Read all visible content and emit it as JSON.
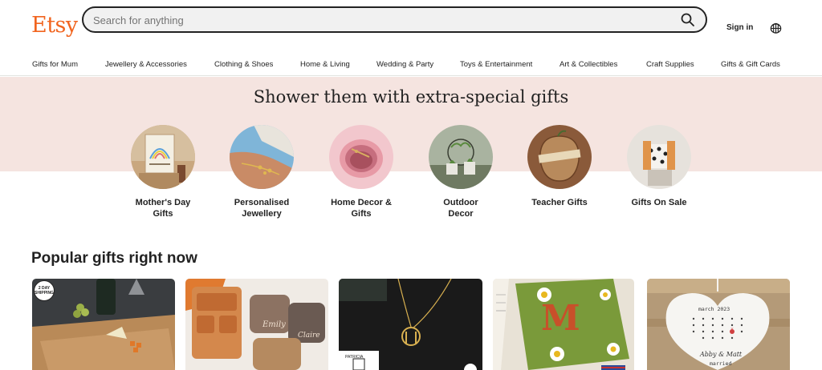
{
  "header": {
    "logo": "Etsy",
    "search": {
      "placeholder": "Search for anything"
    },
    "sign_in": "Sign in",
    "icons": {
      "search": "search-icon",
      "basket": "basket-icon"
    },
    "brand_color": "#f1641e"
  },
  "nav": {
    "items": [
      {
        "label": "Gifts for Mum"
      },
      {
        "label": "Jewellery & Accessories"
      },
      {
        "label": "Clothing & Shoes"
      },
      {
        "label": "Home & Living"
      },
      {
        "label": "Wedding & Party"
      },
      {
        "label": "Toys & Entertainment"
      },
      {
        "label": "Art & Collectibles"
      },
      {
        "label": "Craft Supplies"
      },
      {
        "label": "Gifts & Gift Cards"
      }
    ]
  },
  "hero": {
    "title": "Shower them with extra-special gifts",
    "background": "#f5e4e0",
    "categories": [
      {
        "line1": "Mother's Day",
        "line2": "Gifts"
      },
      {
        "line1": "Personalised",
        "line2": "Jewellery"
      },
      {
        "line1": "Home Decor &",
        "line2": "Gifts"
      },
      {
        "line1": "Outdoor",
        "line2": "Decor"
      },
      {
        "line1": "Teacher Gifts",
        "line2": ""
      },
      {
        "line1": "Gifts On Sale",
        "line2": ""
      }
    ]
  },
  "popular": {
    "title": "Popular gifts right now",
    "cards": [
      {
        "badge_line1": "2 DAY",
        "badge_line2": "SHIPPING"
      },
      {
        "engraving_1": "Emily",
        "engraving_2": "Claire"
      },
      {
        "tag": "PATRICIA"
      },
      {
        "letter": "M"
      },
      {
        "calendar_title": "march 2023",
        "names": "Abby & Matt",
        "caption": "married"
      }
    ]
  }
}
